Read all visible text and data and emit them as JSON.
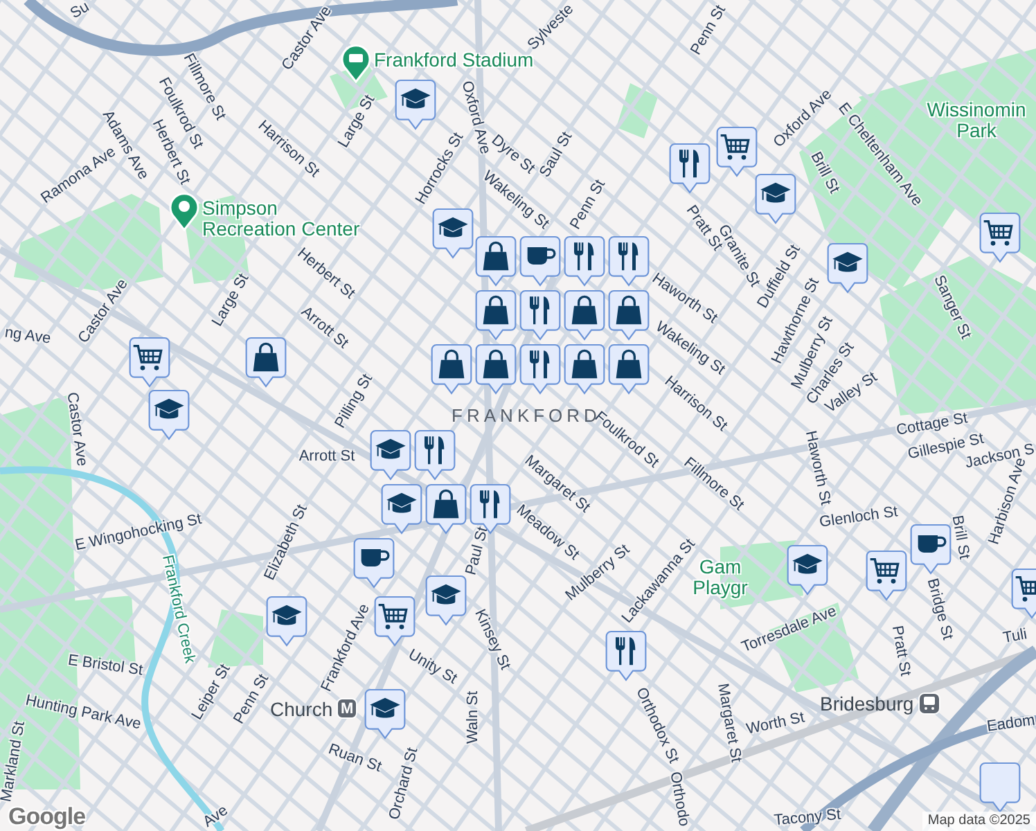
{
  "map": {
    "street_labels": [
      {
        "text": "Su"
      },
      {
        "text": "Castor Ave"
      },
      {
        "text": "Fillmore St"
      },
      {
        "text": "Foulkrod St"
      },
      {
        "text": "Adams Ave"
      },
      {
        "text": "Herbert St"
      },
      {
        "text": "Ramona Ave"
      },
      {
        "text": "Harrison St"
      },
      {
        "text": "Large St"
      },
      {
        "text": "Horrocks St"
      },
      {
        "text": "Oxford Ave"
      },
      {
        "text": "Dyre St"
      },
      {
        "text": "Saul St"
      },
      {
        "text": "Sylveste"
      },
      {
        "text": "Penn St"
      },
      {
        "text": "Oxford Ave"
      },
      {
        "text": "E Cheltenham Ave"
      },
      {
        "text": "Brill St"
      },
      {
        "text": "Pratt St"
      },
      {
        "text": "Granite St"
      },
      {
        "text": "Wakeling St"
      },
      {
        "text": "Penn St"
      },
      {
        "text": "Haworth St"
      },
      {
        "text": "Wakeling St"
      },
      {
        "text": "Duffield St"
      },
      {
        "text": "Hawthorne St"
      },
      {
        "text": "Mulberry St"
      },
      {
        "text": "Charles St"
      },
      {
        "text": "Valley St"
      },
      {
        "text": "Sanger St"
      },
      {
        "text": "Harrison St"
      },
      {
        "text": "Foulkrod St"
      },
      {
        "text": "Margaret St"
      },
      {
        "text": "Meadow St"
      },
      {
        "text": "Fillmore St"
      },
      {
        "text": "Haworth St"
      },
      {
        "text": "Cottage St"
      },
      {
        "text": "Gillespie St"
      },
      {
        "text": "Jackson S"
      },
      {
        "text": "Harbison Ave"
      },
      {
        "text": "Glenloch St"
      },
      {
        "text": "Brill St"
      },
      {
        "text": "Tuli"
      },
      {
        "text": "Mulberry St"
      },
      {
        "text": "Lackawanna St"
      },
      {
        "text": "Bridge St"
      },
      {
        "text": "Pratt St"
      },
      {
        "text": "Torresdale Ave"
      },
      {
        "text": "Orthodox St"
      },
      {
        "text": "Margaret St"
      },
      {
        "text": "Worth St"
      },
      {
        "text": "Eadom"
      },
      {
        "text": "Tacony St"
      },
      {
        "text": "Orthodo"
      },
      {
        "text": "ng Ave"
      },
      {
        "text": "Castor Ave"
      },
      {
        "text": "Castor Ave"
      },
      {
        "text": "Large St"
      },
      {
        "text": "Herbert St"
      },
      {
        "text": "Arrott St"
      },
      {
        "text": "Pilling St"
      },
      {
        "text": "Arrott St"
      },
      {
        "text": "E Wingohocking St"
      },
      {
        "text": "Elizabeth St"
      },
      {
        "text": "Frankford Ave"
      },
      {
        "text": "Paul St"
      },
      {
        "text": "Kinsey St"
      },
      {
        "text": "Unity St"
      },
      {
        "text": "E Bristol St"
      },
      {
        "text": "Leiper St"
      },
      {
        "text": "Penn St"
      },
      {
        "text": "Waln St"
      },
      {
        "text": "Ruan St"
      },
      {
        "text": "Orchard St"
      },
      {
        "text": "Hunting Park Ave"
      },
      {
        "text": "Markland St"
      },
      {
        "text": "Ave"
      }
    ],
    "place_labels": [
      {
        "kind": "stadium",
        "lines": [
          "Frankford Stadium"
        ]
      },
      {
        "kind": "park_pin",
        "lines": [
          "Simpson",
          "Recreation Center"
        ]
      },
      {
        "kind": "park",
        "lines": [
          "Wissinomin",
          "Park"
        ]
      },
      {
        "kind": "park",
        "lines": [
          "Gam",
          "Playgr"
        ]
      },
      {
        "kind": "water",
        "lines": [
          "Frankford Creek"
        ]
      }
    ],
    "area_labels": [
      {
        "text": "FRANKFORD"
      }
    ],
    "stations": [
      {
        "kind": "metro",
        "name": "Church",
        "symbol": "M"
      },
      {
        "kind": "rail",
        "name": "Bridesburg"
      }
    ],
    "markers": [
      {
        "kind": "school"
      },
      {
        "kind": "school"
      },
      {
        "kind": "grocery"
      },
      {
        "kind": "food"
      },
      {
        "kind": "school"
      },
      {
        "kind": "grocery"
      },
      {
        "kind": "school"
      },
      {
        "kind": "food"
      },
      {
        "kind": "food"
      },
      {
        "kind": "cafe"
      },
      {
        "kind": "food"
      },
      {
        "kind": "shop"
      },
      {
        "kind": "shop"
      },
      {
        "kind": "food"
      },
      {
        "kind": "shop"
      },
      {
        "kind": "shop"
      },
      {
        "kind": "shop"
      },
      {
        "kind": "shop"
      },
      {
        "kind": "shop"
      },
      {
        "kind": "shop"
      },
      {
        "kind": "shop"
      },
      {
        "kind": "grocery"
      },
      {
        "kind": "school"
      },
      {
        "kind": "school"
      },
      {
        "kind": "food"
      },
      {
        "kind": "school"
      },
      {
        "kind": "shop"
      },
      {
        "kind": "food"
      },
      {
        "kind": "cafe"
      },
      {
        "kind": "grocery"
      },
      {
        "kind": "school"
      },
      {
        "kind": "school"
      },
      {
        "kind": "school"
      },
      {
        "kind": "school"
      },
      {
        "kind": "grocery"
      },
      {
        "kind": "cafe"
      },
      {
        "kind": "food"
      },
      {
        "kind": "grocery"
      },
      {
        "kind": "blank"
      }
    ]
  },
  "attribution": {
    "logo": "Google",
    "text": "Map data ©2025"
  }
}
